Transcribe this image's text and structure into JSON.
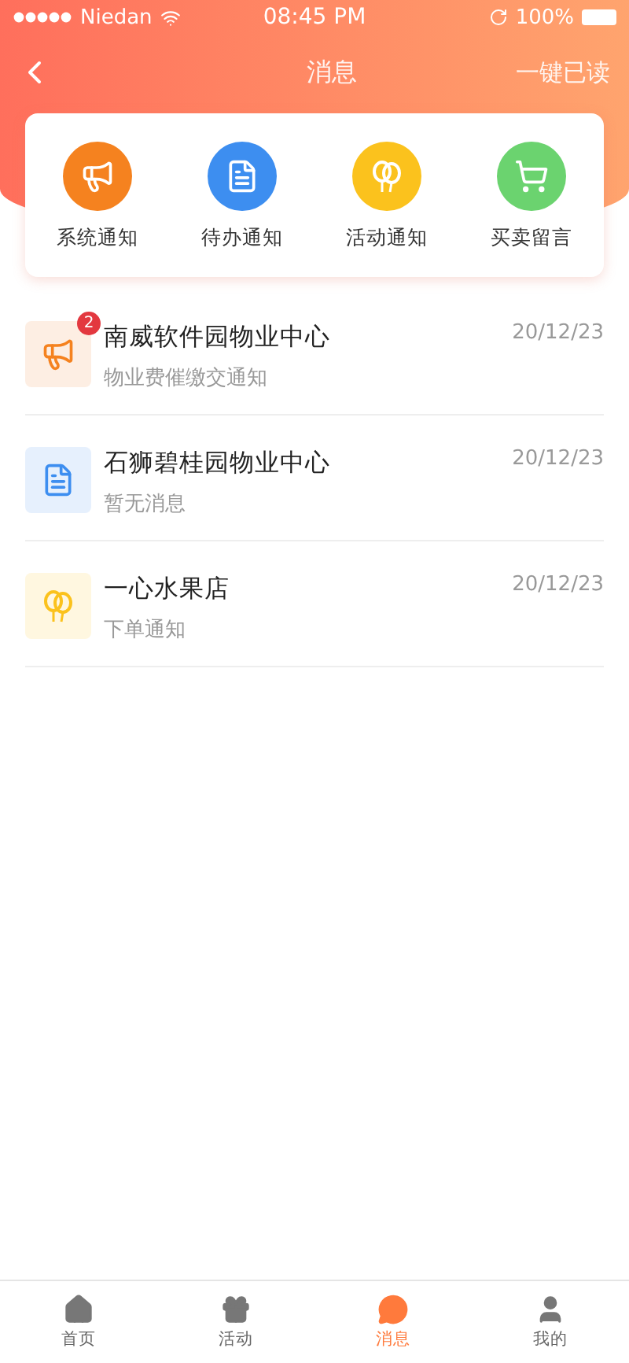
{
  "status_bar": {
    "carrier": "Niedan",
    "time": "08:45 PM",
    "battery": "100%"
  },
  "nav": {
    "title": "消息",
    "action": "一键已读"
  },
  "categories": [
    {
      "label": "系统通知",
      "kind": "system"
    },
    {
      "label": "待办通知",
      "kind": "todo"
    },
    {
      "label": "活动通知",
      "kind": "activity"
    },
    {
      "label": "买卖留言",
      "kind": "trade"
    }
  ],
  "messages": [
    {
      "kind": "system",
      "title": "南威软件园物业中心",
      "subtitle": "物业费催缴交通知",
      "date": "20/12/23",
      "badge": "2"
    },
    {
      "kind": "todo",
      "title": "石狮碧桂园物业中心",
      "subtitle": "暂无消息",
      "date": "20/12/23"
    },
    {
      "kind": "activity",
      "title": "一心水果店",
      "subtitle": "下单通知",
      "date": "20/12/23"
    }
  ],
  "tab_bar": [
    {
      "label": "首页",
      "kind": "home",
      "selected": false
    },
    {
      "label": "活动",
      "kind": "gift",
      "selected": false
    },
    {
      "label": "消息",
      "kind": "message",
      "selected": true
    },
    {
      "label": "我的",
      "kind": "user",
      "selected": false
    }
  ]
}
